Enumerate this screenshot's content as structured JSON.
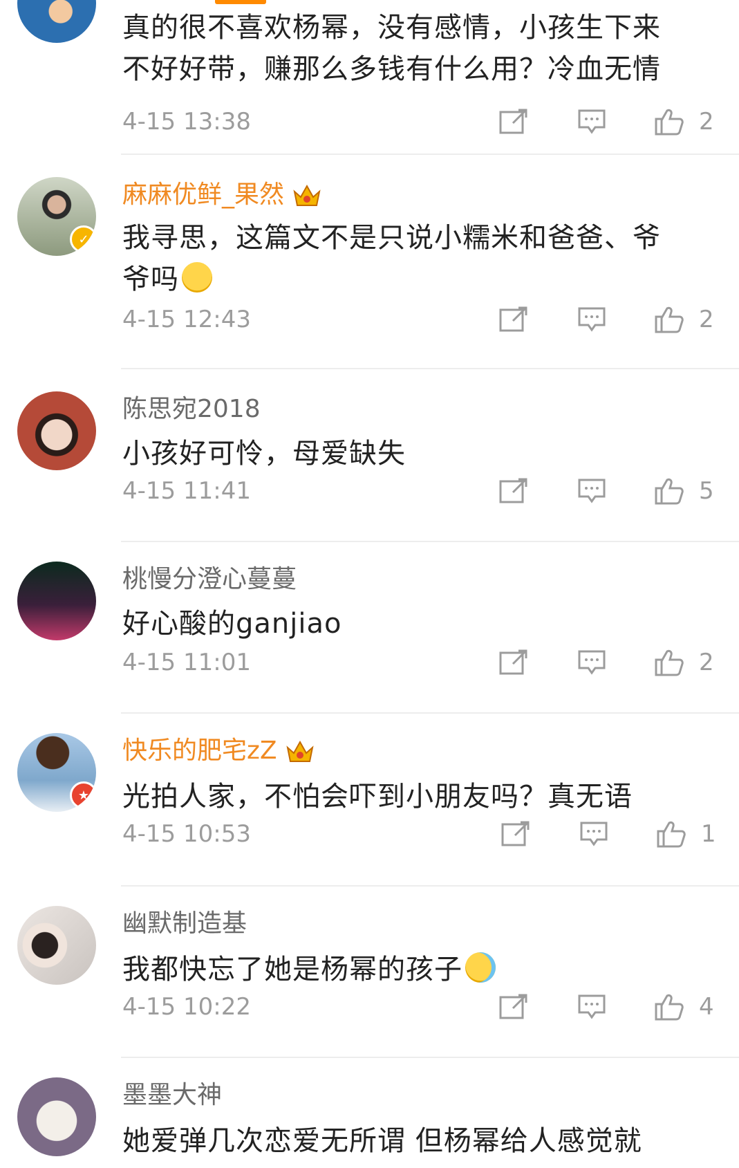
{
  "comments": [
    {
      "user": "",
      "vip": false,
      "text_lines": [
        "真的很不喜欢杨幂，没有感情，小孩生下来",
        "不好好带，赚那么多钱有什么用？冷血无情"
      ],
      "time": "4-15 13:38",
      "likes": "2",
      "avatar_color": "#2c6fb0"
    },
    {
      "user": "麻麻优鲜_果然",
      "vip": true,
      "text_lines": [
        "我寻思，这篇文不是只说小糯米和爸爸、爷",
        "爷吗"
      ],
      "emoji": "smiling-sweat-emoji",
      "time": "4-15 12:43",
      "likes": "2",
      "avatar_color": "#8d9a7e",
      "badge": "verified-badge-icon"
    },
    {
      "user": "陈思宛2018",
      "vip": false,
      "text_lines": [
        "小孩好可怜，母爱缺失"
      ],
      "time": "4-15 11:41",
      "likes": "5",
      "avatar_color": "#b54a38"
    },
    {
      "user": "桃慢分澄心蔓蔓",
      "vip": false,
      "text_lines": [
        "好心酸的ganjiao"
      ],
      "time": "4-15 11:01",
      "likes": "2",
      "avatar_color": "#3a1f3a"
    },
    {
      "user": "快乐的肥宅zZ",
      "vip": true,
      "text_lines": [
        "光拍人家，不怕会吓到小朋友吗？真无语"
      ],
      "time": "4-15 10:53",
      "likes": "1",
      "avatar_color": "#7fa8cc",
      "badge": "star-badge-icon"
    },
    {
      "user": "幽默制造基",
      "vip": false,
      "text_lines": [
        "我都快忘了她是杨幂的孩子"
      ],
      "emoji": "laughing-tears-emoji",
      "time": "4-15 10:22",
      "likes": "4",
      "avatar_color": "#c9c3bf"
    },
    {
      "user": "墨墨大神",
      "vip": false,
      "text_lines": [
        "她爱弹几次恋爱无所谓 但杨幂给人感觉就"
      ],
      "time": "",
      "likes": "",
      "avatar_color": "#7b6a86"
    }
  ],
  "icons": {
    "share": "share-icon",
    "reply": "comment-icon",
    "like": "thumbs-up-icon",
    "crown": "crown-vip-icon"
  },
  "colors": {
    "vip_name": "#f08a22",
    "normal_name": "#6a6a6a",
    "meta": "#9c9c9c",
    "accent": "#ff8a00"
  }
}
